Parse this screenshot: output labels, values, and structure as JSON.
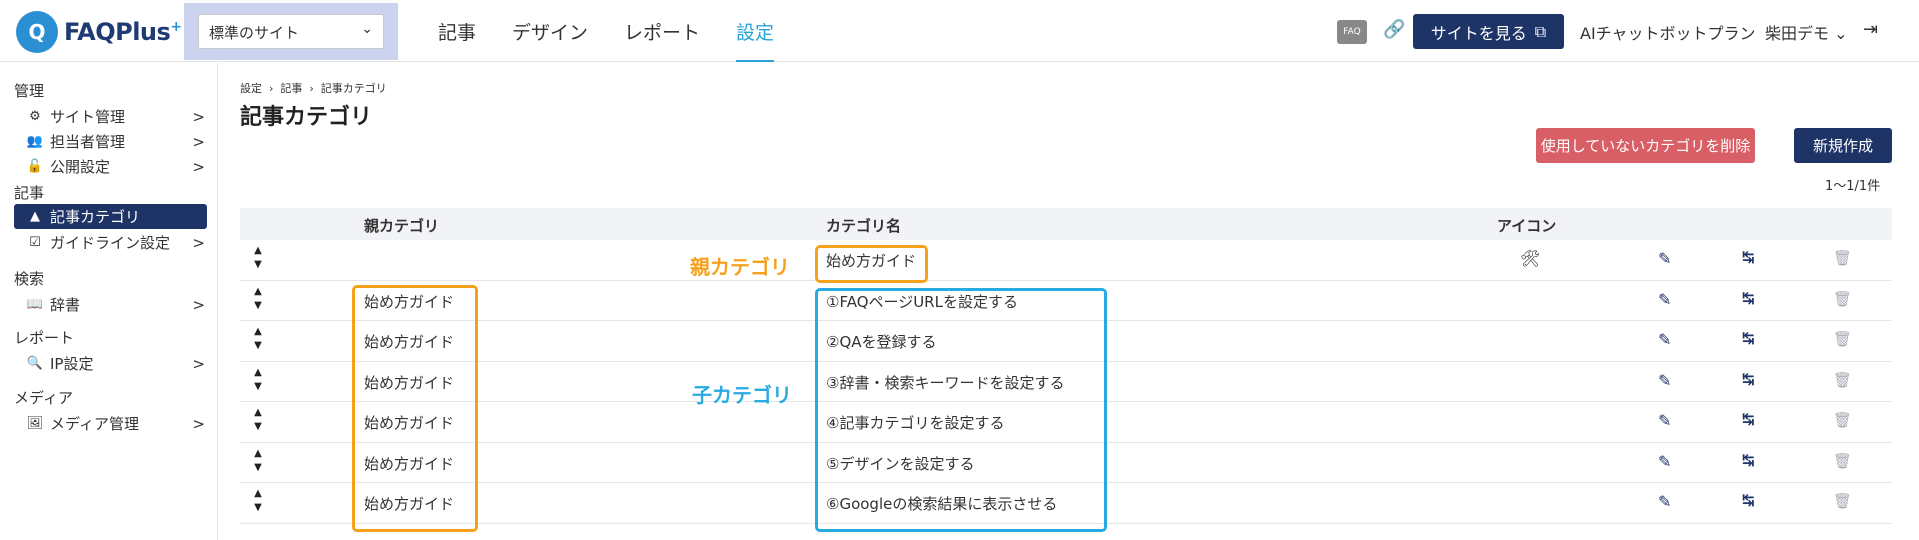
{
  "header": {
    "logo_mark": "Q",
    "logo_text": "FAQPlus",
    "logo_plus": "+",
    "site_select": "標準のサイト",
    "nav": [
      "記事",
      "デザイン",
      "レポート",
      "設定"
    ],
    "active_nav": "設定",
    "faq_badge": "FAQ",
    "view_site": "サイトを見る",
    "plan": "AIチャットボットプラン",
    "user": "柴田デモ"
  },
  "sidebar": {
    "sections": [
      {
        "title": "管理",
        "items": [
          {
            "label": "サイト管理",
            "icon": "gear-icon"
          },
          {
            "label": "担当者管理",
            "icon": "users-icon"
          },
          {
            "label": "公開設定",
            "icon": "lock-icon"
          }
        ]
      },
      {
        "title": "記事",
        "items": [
          {
            "label": "記事カテゴリ",
            "icon": "category-icon",
            "active": true
          },
          {
            "label": "ガイドライン設定",
            "icon": "checklist-icon"
          }
        ]
      },
      {
        "title": "検索",
        "items": [
          {
            "label": "辞書",
            "icon": "book-icon"
          }
        ]
      },
      {
        "title": "レポート",
        "items": [
          {
            "label": "IP設定",
            "icon": "ip-search-icon"
          }
        ]
      },
      {
        "title": "メディア",
        "items": [
          {
            "label": "メディア管理",
            "icon": "media-icon"
          }
        ]
      }
    ]
  },
  "breadcrumb": [
    "設定",
    "記事",
    "記事カテゴリ"
  ],
  "page_title": "記事カテゴリ",
  "actions": {
    "delete_unused": "使用していないカテゴリを削除",
    "new": "新規作成"
  },
  "count": "1〜1/1件",
  "table": {
    "headers": {
      "parent": "親カテゴリ",
      "name": "カテゴリ名",
      "icon": "アイコン"
    },
    "rows": [
      {
        "parent": "",
        "name": "始め方ガイド",
        "icon": "tools-icon"
      },
      {
        "parent": "始め方ガイド",
        "name": "①FAQページURLを設定する"
      },
      {
        "parent": "始め方ガイド",
        "name": "②QAを登録する"
      },
      {
        "parent": "始め方ガイド",
        "name": "③辞書・検索キーワードを設定する"
      },
      {
        "parent": "始め方ガイド",
        "name": "④記事カテゴリを設定する"
      },
      {
        "parent": "始め方ガイド",
        "name": "⑤デザインを設定する"
      },
      {
        "parent": "始め方ガイド",
        "name": "⑥Googleの検索結果に表示させる"
      }
    ]
  },
  "annotations": {
    "parent_label": "親カテゴリ",
    "child_label": "子カテゴリ",
    "parent_color": "#f5a11c",
    "child_color": "#29aae3"
  },
  "colors": {
    "navy": "#1e3467",
    "accent": "#29a3d8",
    "danger": "#d95f66"
  }
}
